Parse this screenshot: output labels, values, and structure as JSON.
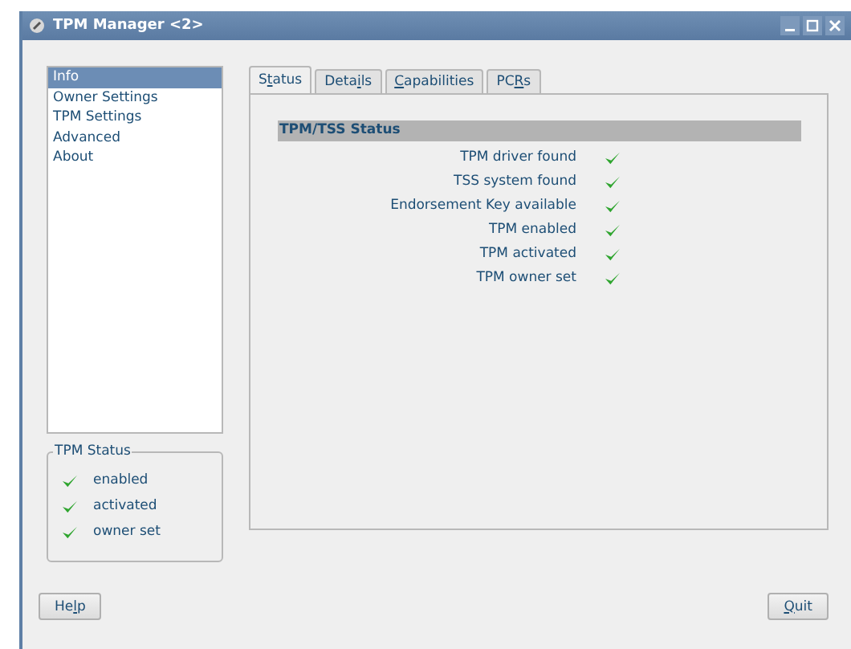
{
  "window": {
    "title": "TPM Manager <2>"
  },
  "sidebar": {
    "items": [
      {
        "label": "Info",
        "selected": true
      },
      {
        "label": "Owner Settings",
        "selected": false
      },
      {
        "label": "TPM Settings",
        "selected": false
      },
      {
        "label": "Advanced",
        "selected": false
      },
      {
        "label": "About",
        "selected": false
      }
    ]
  },
  "tpm_status": {
    "title": "TPM Status",
    "items": [
      {
        "label": "enabled",
        "checked": true
      },
      {
        "label": "activated",
        "checked": true
      },
      {
        "label": "owner set",
        "checked": true
      }
    ]
  },
  "tabs": [
    {
      "label": {
        "pre": "S",
        "key": "t",
        "post": "atus"
      },
      "selected": true
    },
    {
      "label": {
        "pre": "Deta",
        "key": "i",
        "post": "ls"
      },
      "selected": false
    },
    {
      "label": {
        "key": "C",
        "post": "apabilities"
      },
      "selected": false
    },
    {
      "label": {
        "pre": "PC",
        "key": "R",
        "post": "s"
      },
      "selected": false
    }
  ],
  "status_section": {
    "heading": "TPM/TSS Status",
    "rows": [
      {
        "label": "TPM driver found",
        "checked": true
      },
      {
        "label": "TSS system found",
        "checked": true
      },
      {
        "label": "Endorsement Key available",
        "checked": true
      },
      {
        "label": "TPM enabled",
        "checked": true
      },
      {
        "label": "TPM activated",
        "checked": true
      },
      {
        "label": "TPM owner set",
        "checked": true
      }
    ]
  },
  "buttons": [
    {
      "label": {
        "pre": "He",
        "key": "l",
        "post": "p"
      }
    },
    {
      "label": {
        "key": "Q",
        "post": "uit"
      }
    }
  ]
}
